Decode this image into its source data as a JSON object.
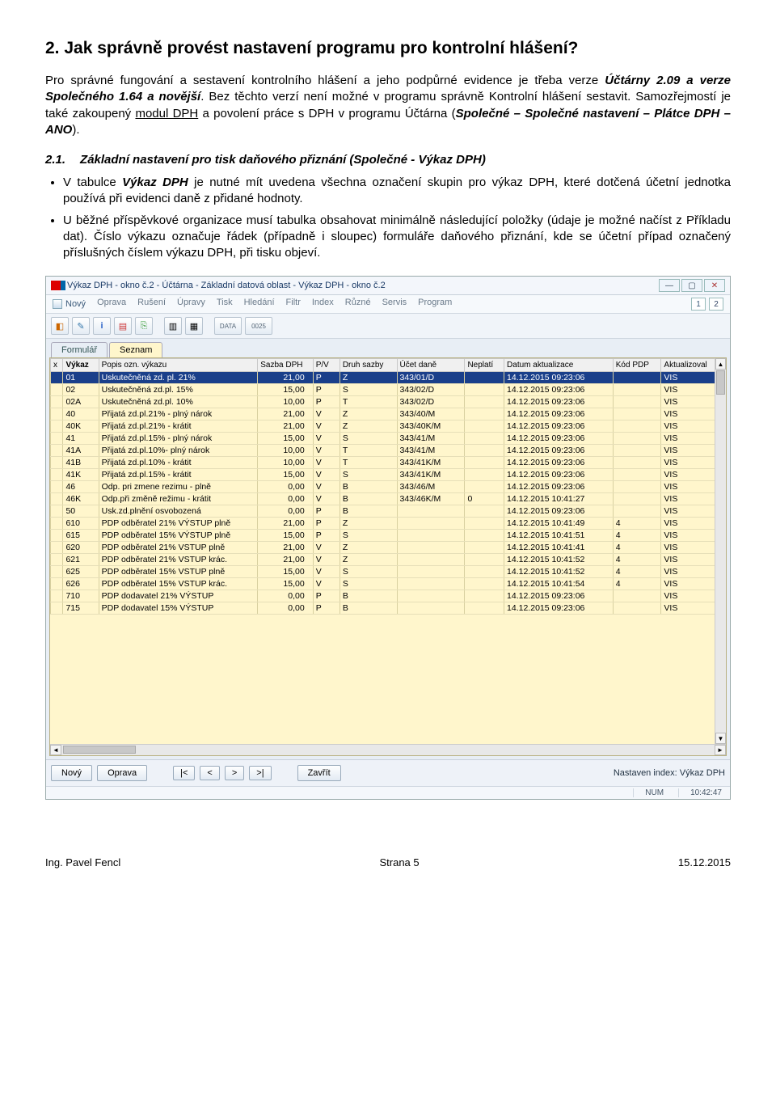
{
  "doc": {
    "h2": "2. Jak správně provést nastavení programu pro kontrolní hlášení?",
    "p1a": "Pro správné fungování a sestavení kontrolního hlášení a jeho podpůrné evidence je třeba verze ",
    "p1b": "Účtárny 2.09 a verze Společného 1.64 a novější",
    "p1c": ". Bez těchto verzí není možné v programu správně Kontrolní hlášení sestavit. Samozřejmostí je také zakoupený ",
    "p1d": "modul DPH",
    "p1e": " a povolení práce s DPH v programu Účtárna (",
    "p1f": "Společné – Společné nastavení – Plátce DPH – ANO",
    "p1g": ").",
    "sec_num": "2.1.",
    "sec_title": "Základní nastavení pro tisk daňového přiznání (Společné -  Výkaz DPH)",
    "b1a": "V tabulce ",
    "b1b": "Výkaz DPH",
    "b1c": " je nutné mít uvedena všechna označení skupin pro výkaz DPH, které dotčená účetní jednotka používá při evidenci daně z přidané hodnoty.",
    "b2": "U běžné příspěvkové organizace musí tabulka obsahovat minimálně následující položky (údaje je možné načíst z Příkladu dat). Číslo výkazu označuje řádek (případně i sloupec) formuláře daňového přiznání, kde se účetní případ označený příslušných číslem výkazu DPH, při tisku objeví."
  },
  "app": {
    "title": "Výkaz DPH - okno č.2 - Účtárna - Základní datová oblast - Výkaz DPH - okno č.2",
    "menus": [
      "Nový",
      "Oprava",
      "Rušení",
      "Úpravy",
      "Tisk",
      "Hledání",
      "Filtr",
      "Index",
      "Různé",
      "Servis",
      "Program"
    ],
    "pages": [
      "1",
      "2"
    ],
    "toolbar_labels": [
      "DATA",
      "0025"
    ],
    "tabs": {
      "formular": "Formulář",
      "seznam": "Seznam"
    },
    "columns": [
      "x",
      "Výkaz",
      "Popis ozn. výkazu",
      "Sazba DPH",
      "P/V",
      "Druh sazby",
      "Účet daně",
      "Neplatí",
      "Datum aktualizace",
      "Kód PDP",
      "Aktualizoval"
    ],
    "rows": [
      {
        "x": "",
        "v": "01",
        "popis": "Uskutečněná zd. pl. 21%",
        "sazba": "21,00",
        "pv": "P",
        "druh": "Z",
        "ucet": "343/01/D",
        "nep": "",
        "dat": "14.12.2015 09:23:06",
        "kod": "",
        "akt": "VIS",
        "sel": true
      },
      {
        "x": "",
        "v": "02",
        "popis": "Uskutečněná zd.pl. 15%",
        "sazba": "15,00",
        "pv": "P",
        "druh": "S",
        "ucet": "343/02/D",
        "nep": "",
        "dat": "14.12.2015 09:23:06",
        "kod": "",
        "akt": "VIS"
      },
      {
        "x": "",
        "v": "02A",
        "popis": "Uskutečněná zd.pl. 10%",
        "sazba": "10,00",
        "pv": "P",
        "druh": "T",
        "ucet": "343/02/D",
        "nep": "",
        "dat": "14.12.2015 09:23:06",
        "kod": "",
        "akt": "VIS"
      },
      {
        "x": "",
        "v": "40",
        "popis": "Přijatá zd.pl.21% - plný nárok",
        "sazba": "21,00",
        "pv": "V",
        "druh": "Z",
        "ucet": "343/40/M",
        "nep": "",
        "dat": "14.12.2015 09:23:06",
        "kod": "",
        "akt": "VIS"
      },
      {
        "x": "",
        "v": "40K",
        "popis": "Přijatá zd.pl.21% - krátit",
        "sazba": "21,00",
        "pv": "V",
        "druh": "Z",
        "ucet": "343/40K/M",
        "nep": "",
        "dat": "14.12.2015 09:23:06",
        "kod": "",
        "akt": "VIS"
      },
      {
        "x": "",
        "v": "41",
        "popis": "Přijatá zd.pl.15% - plný nárok",
        "sazba": "15,00",
        "pv": "V",
        "druh": "S",
        "ucet": "343/41/M",
        "nep": "",
        "dat": "14.12.2015 09:23:06",
        "kod": "",
        "akt": "VIS"
      },
      {
        "x": "",
        "v": "41A",
        "popis": "Přijatá zd.pl.10%- plný nárok",
        "sazba": "10,00",
        "pv": "V",
        "druh": "T",
        "ucet": "343/41/M",
        "nep": "",
        "dat": "14.12.2015 09:23:06",
        "kod": "",
        "akt": "VIS"
      },
      {
        "x": "",
        "v": "41B",
        "popis": "Přijatá zd.pl.10% - krátit",
        "sazba": "10,00",
        "pv": "V",
        "druh": "T",
        "ucet": "343/41K/M",
        "nep": "",
        "dat": "14.12.2015 09:23:06",
        "kod": "",
        "akt": "VIS"
      },
      {
        "x": "",
        "v": "41K",
        "popis": "Přijatá zd.pl.15% - krátit",
        "sazba": "15,00",
        "pv": "V",
        "druh": "S",
        "ucet": "343/41K/M",
        "nep": "",
        "dat": "14.12.2015 09:23:06",
        "kod": "",
        "akt": "VIS"
      },
      {
        "x": "",
        "v": "46",
        "popis": "Odp. pri zmene rezimu - plně",
        "sazba": "0,00",
        "pv": "V",
        "druh": "B",
        "ucet": "343/46/M",
        "nep": "",
        "dat": "14.12.2015 09:23:06",
        "kod": "",
        "akt": "VIS"
      },
      {
        "x": "",
        "v": "46K",
        "popis": "Odp.při změně režimu - krátit",
        "sazba": "0,00",
        "pv": "V",
        "druh": "B",
        "ucet": "343/46K/M",
        "nep": "0",
        "dat": "14.12.2015 10:41:27",
        "kod": "",
        "akt": "VIS"
      },
      {
        "x": "",
        "v": "50",
        "popis": "Usk.zd.plnění osvobozená",
        "sazba": "0,00",
        "pv": "P",
        "druh": "B",
        "ucet": "",
        "nep": "",
        "dat": "14.12.2015 09:23:06",
        "kod": "",
        "akt": "VIS"
      },
      {
        "x": "",
        "v": "610",
        "popis": "PDP odběratel 21% VÝSTUP plně",
        "sazba": "21,00",
        "pv": "P",
        "druh": "Z",
        "ucet": "",
        "nep": "",
        "dat": "14.12.2015 10:41:49",
        "kod": "4",
        "akt": "VIS"
      },
      {
        "x": "",
        "v": "615",
        "popis": "PDP odběratel 15% VÝSTUP plně",
        "sazba": "15,00",
        "pv": "P",
        "druh": "S",
        "ucet": "",
        "nep": "",
        "dat": "14.12.2015 10:41:51",
        "kod": "4",
        "akt": "VIS"
      },
      {
        "x": "",
        "v": "620",
        "popis": "PDP odběratel 21% VSTUP plně",
        "sazba": "21,00",
        "pv": "V",
        "druh": "Z",
        "ucet": "",
        "nep": "",
        "dat": "14.12.2015 10:41:41",
        "kod": "4",
        "akt": "VIS"
      },
      {
        "x": "",
        "v": "621",
        "popis": "PDP odběratel 21% VSTUP krác.",
        "sazba": "21,00",
        "pv": "V",
        "druh": "Z",
        "ucet": "",
        "nep": "",
        "dat": "14.12.2015 10:41:52",
        "kod": "4",
        "akt": "VIS"
      },
      {
        "x": "",
        "v": "625",
        "popis": "PDP odběratel 15% VSTUP plně",
        "sazba": "15,00",
        "pv": "V",
        "druh": "S",
        "ucet": "",
        "nep": "",
        "dat": "14.12.2015 10:41:52",
        "kod": "4",
        "akt": "VIS"
      },
      {
        "x": "",
        "v": "626",
        "popis": "PDP odběratel 15% VSTUP krác.",
        "sazba": "15,00",
        "pv": "V",
        "druh": "S",
        "ucet": "",
        "nep": "",
        "dat": "14.12.2015 10:41:54",
        "kod": "4",
        "akt": "VIS"
      },
      {
        "x": "",
        "v": "710",
        "popis": "PDP dodavatel 21% VÝSTUP",
        "sazba": "0,00",
        "pv": "P",
        "druh": "B",
        "ucet": "",
        "nep": "",
        "dat": "14.12.2015 09:23:06",
        "kod": "",
        "akt": "VIS"
      },
      {
        "x": "",
        "v": "715",
        "popis": "PDP dodavatel 15% VÝSTUP",
        "sazba": "0,00",
        "pv": "P",
        "druh": "B",
        "ucet": "",
        "nep": "",
        "dat": "14.12.2015 09:23:06",
        "kod": "",
        "akt": "VIS"
      }
    ],
    "bottom": {
      "novy": "Nový",
      "oprava": "Oprava",
      "first": "|<",
      "prev": "<",
      "next": ">",
      "last": ">|",
      "zavrit": "Zavřít",
      "index": "Nastaven index: Výkaz DPH"
    },
    "status": {
      "num": "NUM",
      "time": "10:42:47"
    }
  },
  "footer": {
    "left": "Ing. Pavel Fencl",
    "mid": "Strana 5",
    "right": "15.12.2015"
  }
}
